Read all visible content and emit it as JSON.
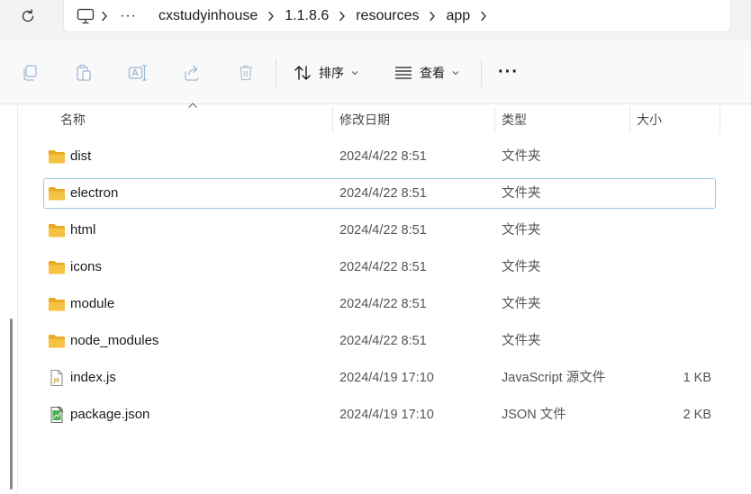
{
  "address": {
    "overflow": "···",
    "crumbs": [
      "cxstudyinhouse",
      "1.1.8.6",
      "resources",
      "app"
    ]
  },
  "toolbar": {
    "sort_label": "排序",
    "view_label": "查看",
    "more_label": "···"
  },
  "columns": {
    "name": "名称",
    "modified": "修改日期",
    "type": "类型",
    "size": "大小"
  },
  "files": [
    {
      "name": "dist",
      "modified": "2024/4/22 8:51",
      "type": "文件夹",
      "size": "",
      "icon": "folder-icon"
    },
    {
      "name": "electron",
      "modified": "2024/4/22 8:51",
      "type": "文件夹",
      "size": "",
      "icon": "folder-icon"
    },
    {
      "name": "html",
      "modified": "2024/4/22 8:51",
      "type": "文件夹",
      "size": "",
      "icon": "folder-icon"
    },
    {
      "name": "icons",
      "modified": "2024/4/22 8:51",
      "type": "文件夹",
      "size": "",
      "icon": "folder-icon"
    },
    {
      "name": "module",
      "modified": "2024/4/22 8:51",
      "type": "文件夹",
      "size": "",
      "icon": "folder-icon"
    },
    {
      "name": "node_modules",
      "modified": "2024/4/22 8:51",
      "type": "文件夹",
      "size": "",
      "icon": "folder-icon"
    },
    {
      "name": "index.js",
      "modified": "2024/4/19 17:10",
      "type": "JavaScript 源文件",
      "size": "1 KB",
      "icon": "js-file-icon"
    },
    {
      "name": "package.json",
      "modified": "2024/4/19 17:10",
      "type": "JSON 文件",
      "size": "2 KB",
      "icon": "json-file-icon"
    }
  ],
  "colors": {
    "folder": "#f5c242",
    "folder_dark": "#e8a820",
    "selection_border": "#99c7e6"
  }
}
